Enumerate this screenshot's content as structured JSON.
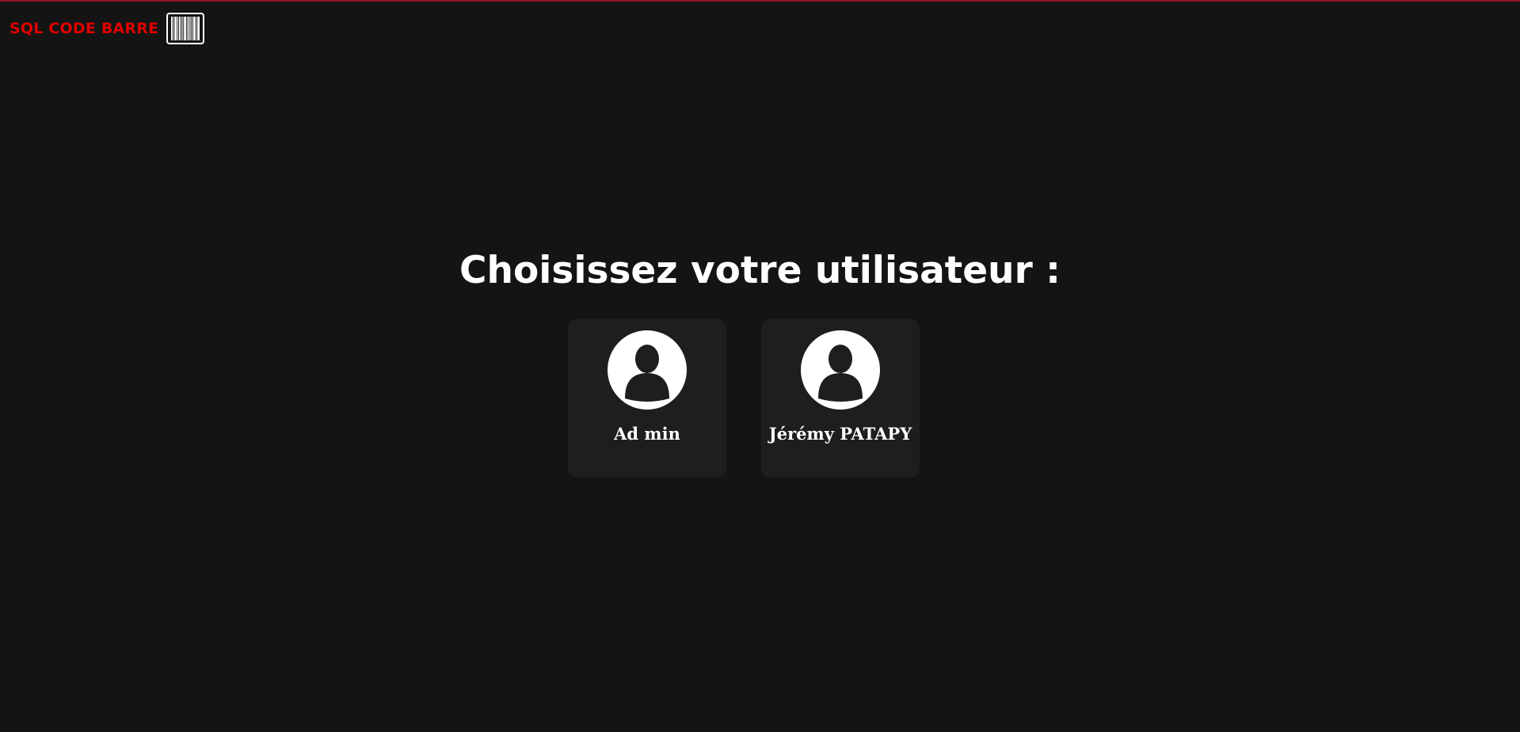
{
  "header": {
    "brand_text": "SQL CODE BARRE",
    "brand_icon": "barcode-icon",
    "accent_color": "#e00000"
  },
  "main": {
    "title": "Choisissez votre utilisateur :",
    "users": [
      {
        "name": "Ad min",
        "icon": "user-avatar-icon"
      },
      {
        "name": "Jérémy PATAPY",
        "icon": "user-avatar-icon"
      }
    ]
  }
}
